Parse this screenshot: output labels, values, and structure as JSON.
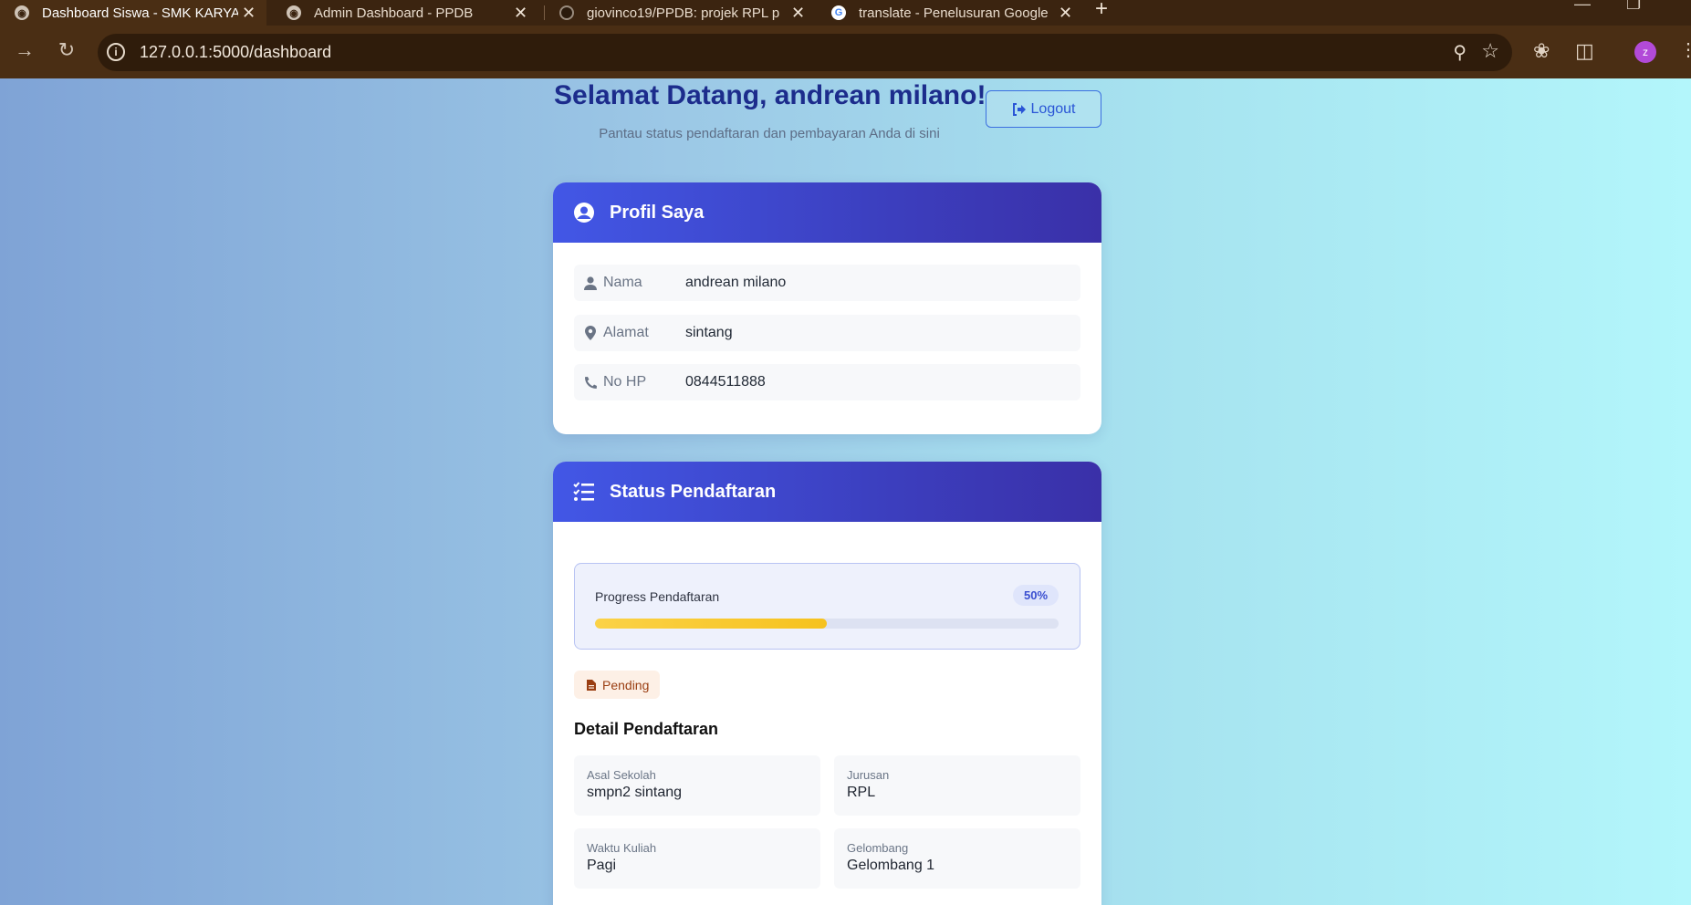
{
  "browser": {
    "tabs": [
      {
        "title": "Dashboard Siswa - SMK KARYA",
        "favicon": "globe-icon",
        "active": true
      },
      {
        "title": "Admin Dashboard - PPDB",
        "favicon": "globe-icon",
        "active": false
      },
      {
        "title": "giovinco19/PPDB: projek RPL p",
        "favicon": "github-icon",
        "active": false
      },
      {
        "title": "translate - Penelusuran Google",
        "favicon": "google-icon",
        "active": false
      }
    ],
    "url": "127.0.0.1:5000/dashboard",
    "profile_initial": "z",
    "google_letter": "G"
  },
  "header": {
    "welcome": "Selamat Datang, andrean milano!",
    "subtitle": "Pantau status pendaftaran dan pembayaran Anda di sini",
    "logout_label": "Logout"
  },
  "profile": {
    "title": "Profil Saya",
    "fields": [
      {
        "label": "Nama",
        "value": "andrean milano",
        "icon": "user-icon"
      },
      {
        "label": "Alamat",
        "value": "sintang",
        "icon": "map-pin-icon"
      },
      {
        "label": "No HP",
        "value": "0844511888",
        "icon": "phone-icon"
      }
    ]
  },
  "status": {
    "title": "Status Pendaftaran",
    "progress_label": "Progress Pendaftaran",
    "progress_percent_text": "50%",
    "progress_value": 0.5,
    "badge": "Pending",
    "detail_title": "Detail Pendaftaran",
    "details": [
      {
        "label": "Asal Sekolah",
        "value": "smpn2 sintang"
      },
      {
        "label": "Jurusan",
        "value": "RPL"
      },
      {
        "label": "Waktu Kuliah",
        "value": "Pagi"
      },
      {
        "label": "Gelombang",
        "value": "Gelombang 1"
      }
    ]
  },
  "colors": {
    "header_gradient_start": "#4257e6",
    "header_gradient_end": "#3a30a8",
    "welcome_text": "#1c2c8c",
    "progress_fill": "#f6c21e",
    "badge_text": "#9a3e12",
    "badge_bg": "#fdf0e6"
  }
}
